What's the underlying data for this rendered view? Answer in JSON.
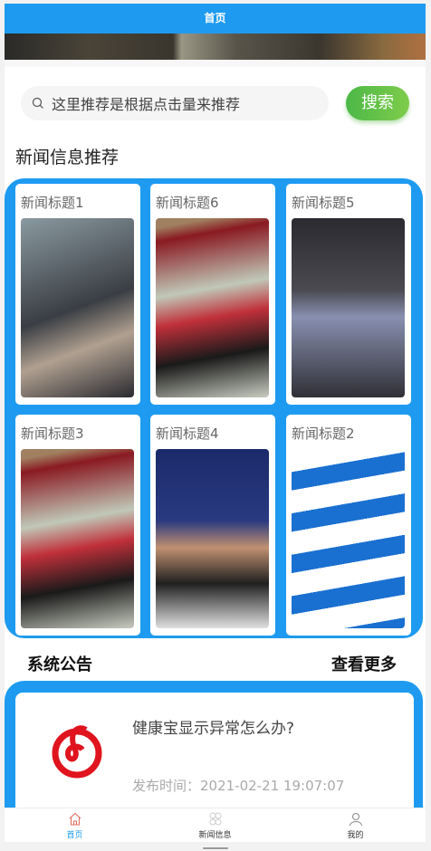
{
  "header": {
    "title": "首页"
  },
  "search": {
    "placeholder": "这里推荐是根据点击量来推荐",
    "button": "搜索",
    "icon": "search-icon"
  },
  "news_section": {
    "title": "新闻信息推荐",
    "items": [
      {
        "title": "新闻标题1"
      },
      {
        "title": "新闻标题6"
      },
      {
        "title": "新闻标题5"
      },
      {
        "title": "新闻标题3"
      },
      {
        "title": "新闻标题4"
      },
      {
        "title": "新闻标题2"
      }
    ]
  },
  "announcement": {
    "title": "系统公告",
    "more": "查看更多",
    "items": [
      {
        "title": "健康宝显示异常怎么办?",
        "time": "发布时间：2021-02-21 19:07:07"
      }
    ]
  },
  "nav": {
    "items": [
      {
        "label": "首页",
        "icon": "home-icon",
        "active": true
      },
      {
        "label": "新闻信息",
        "icon": "grid-icon"
      },
      {
        "label": "我的",
        "icon": "user-icon"
      }
    ]
  },
  "colors": {
    "primary": "#1e9bf0",
    "search_button": "#5bbf48",
    "logo": "#e0141e"
  }
}
